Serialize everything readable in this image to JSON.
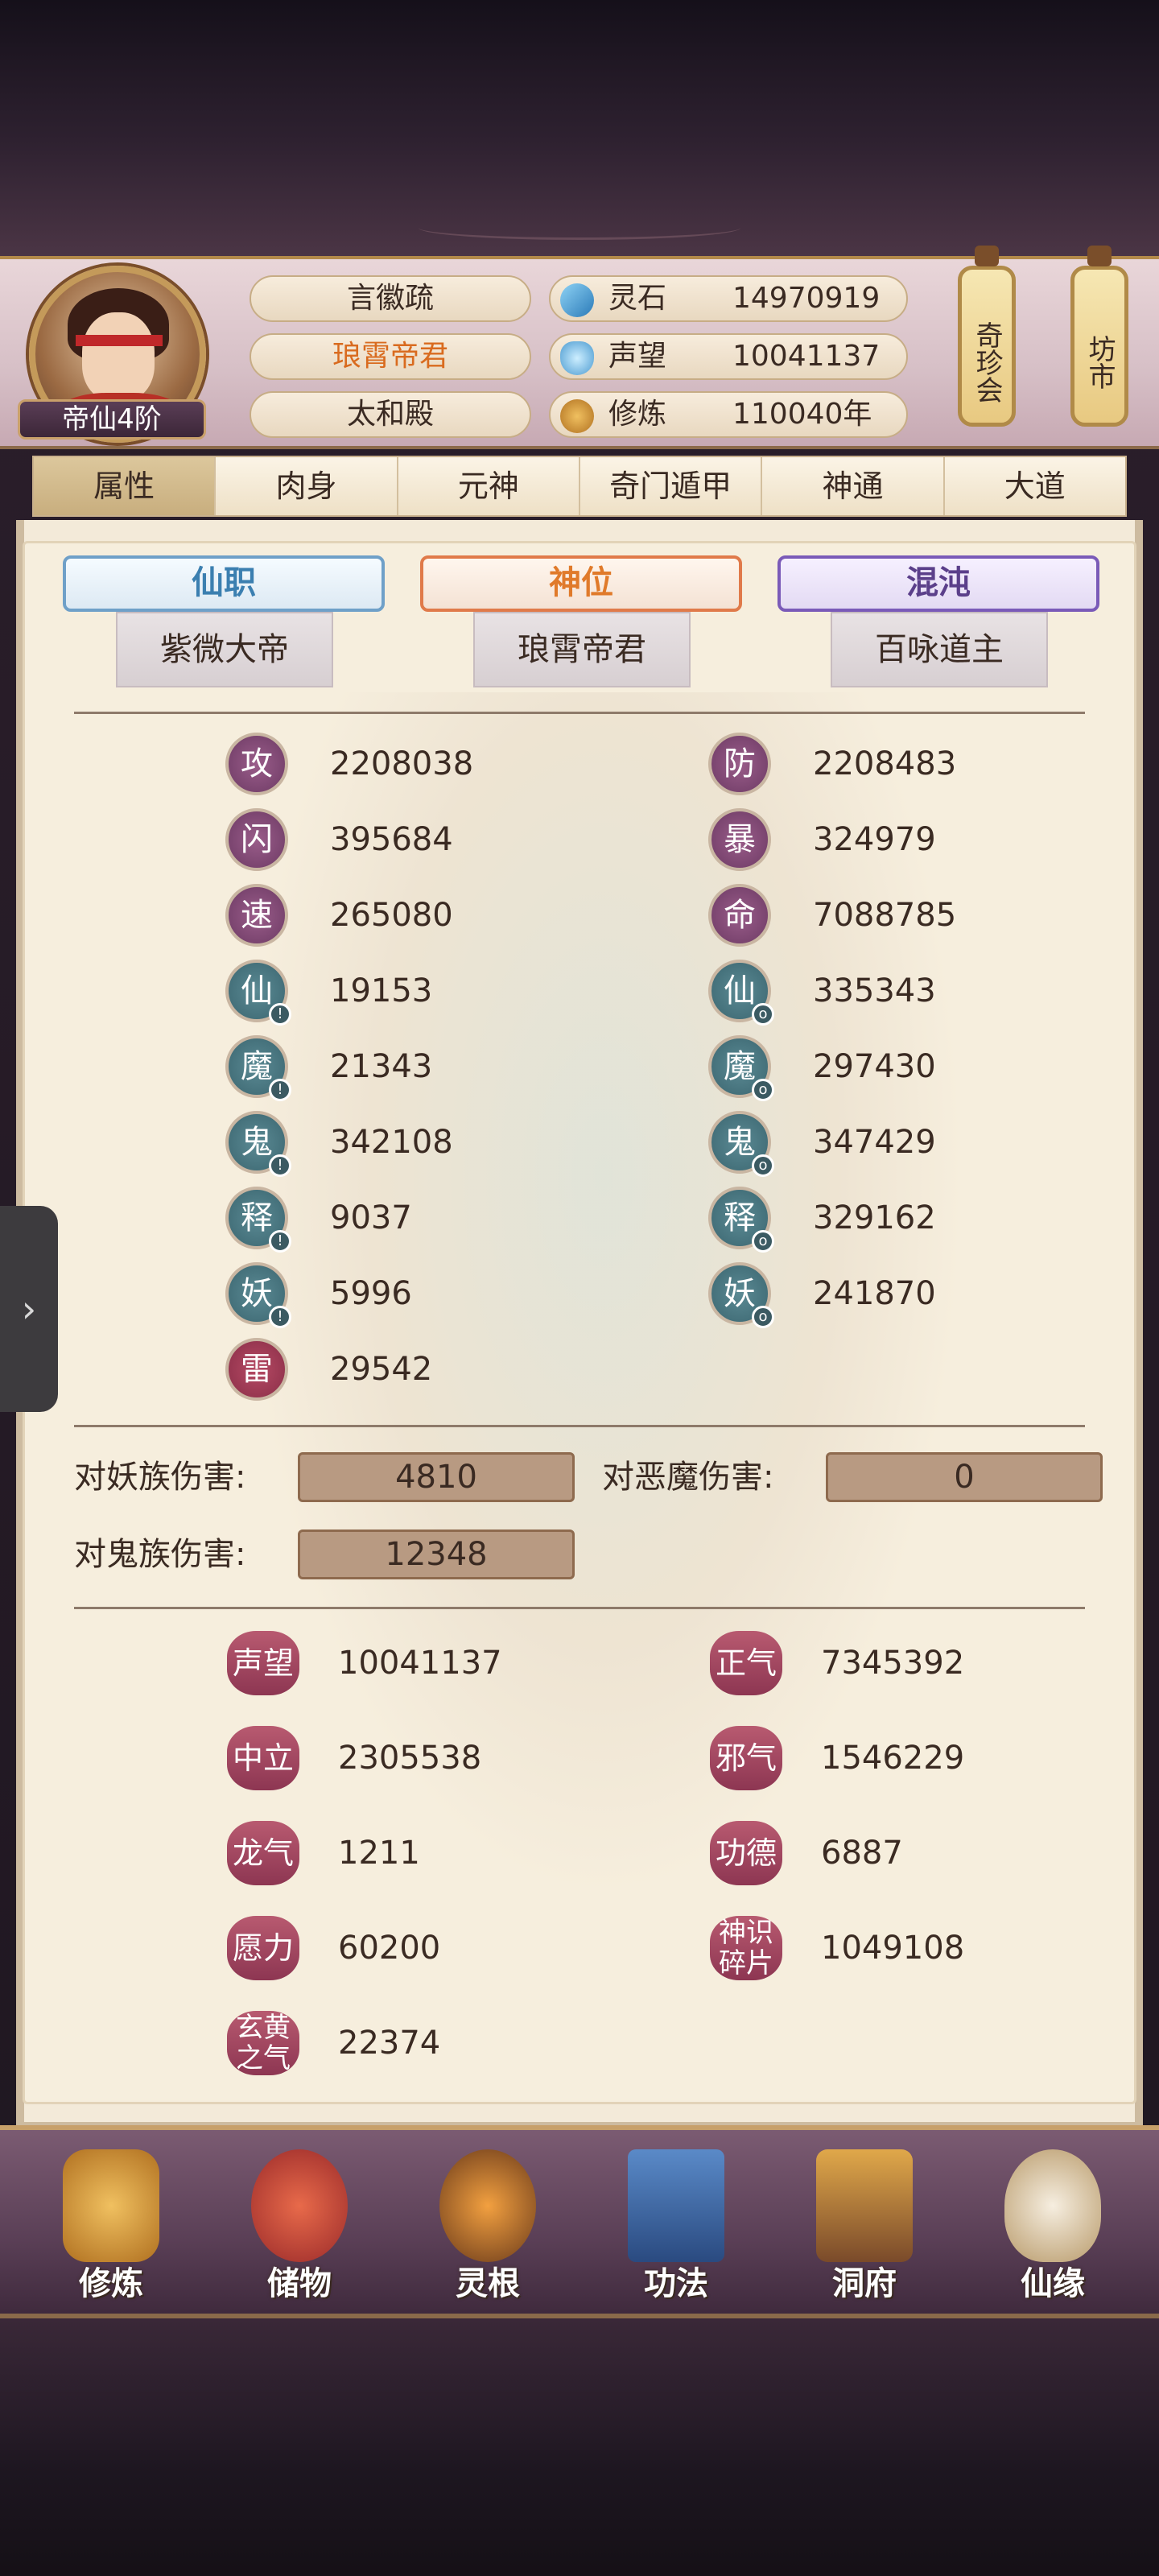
{
  "player": {
    "rank": "帝仙4阶",
    "names": [
      "言徽疏",
      "琅霄帝君",
      "太和殿"
    ]
  },
  "resources": [
    {
      "label": "灵石",
      "value": "14970919",
      "icon": "spirit-stone-icon"
    },
    {
      "label": "声望",
      "value": "10041137",
      "icon": "prestige-crystal-icon"
    },
    {
      "label": "修炼",
      "value": "110040年",
      "icon": "meditation-icon"
    }
  ],
  "lanterns": [
    "奇珍会",
    "坊市"
  ],
  "tabs": [
    "属性",
    "肉身",
    "元神",
    "奇门遁甲",
    "神通",
    "大道"
  ],
  "titles": [
    {
      "heading": "仙职",
      "value": "紫微大帝",
      "color": "#3b7fb0"
    },
    {
      "heading": "神位",
      "value": "琅霄帝君",
      "color": "#e07a2a"
    },
    {
      "heading": "混沌",
      "value": "百咏道主",
      "color": "#5b3f8a"
    }
  ],
  "stats_left": [
    {
      "icon": "攻",
      "value": "2208038",
      "style": "purple",
      "mark": false
    },
    {
      "icon": "闪",
      "value": "395684",
      "style": "purple",
      "mark": false
    },
    {
      "icon": "速",
      "value": "265080",
      "style": "purple",
      "mark": false
    },
    {
      "icon": "仙",
      "value": "19153",
      "style": "teal",
      "mark": true
    },
    {
      "icon": "魔",
      "value": "21343",
      "style": "teal",
      "mark": true
    },
    {
      "icon": "鬼",
      "value": "342108",
      "style": "teal",
      "mark": true
    },
    {
      "icon": "释",
      "value": "9037",
      "style": "teal",
      "mark": true
    },
    {
      "icon": "妖",
      "value": "5996",
      "style": "teal",
      "mark": true
    },
    {
      "icon": "雷",
      "value": "29542",
      "style": "red",
      "mark": false
    }
  ],
  "stats_right": [
    {
      "icon": "防",
      "value": "2208483",
      "style": "purple",
      "mark": false
    },
    {
      "icon": "暴",
      "value": "324979",
      "style": "purple",
      "mark": false
    },
    {
      "icon": "命",
      "value": "7088785",
      "style": "purple",
      "mark": false
    },
    {
      "icon": "仙",
      "value": "335343",
      "style": "teal",
      "mark": true
    },
    {
      "icon": "魔",
      "value": "297430",
      "style": "teal",
      "mark": true
    },
    {
      "icon": "鬼",
      "value": "347429",
      "style": "teal",
      "mark": true
    },
    {
      "icon": "释",
      "value": "329162",
      "style": "teal",
      "mark": true
    },
    {
      "icon": "妖",
      "value": "241870",
      "style": "teal",
      "mark": true
    }
  ],
  "damage": [
    {
      "label": "对妖族伤害:",
      "value": "4810"
    },
    {
      "label": "对恶魔伤害:",
      "value": "0"
    },
    {
      "label": "对鬼族伤害:",
      "value": "12348"
    }
  ],
  "reputation_left": [
    {
      "label": "声望",
      "value": "10041137"
    },
    {
      "label": "中立",
      "value": "2305538"
    },
    {
      "label": "龙气",
      "value": "1211"
    },
    {
      "label": "愿力",
      "value": "60200"
    },
    {
      "label": "玄黄之气",
      "value": "22374"
    }
  ],
  "reputation_right": [
    {
      "label": "正气",
      "value": "7345392"
    },
    {
      "label": "邪气",
      "value": "1546229"
    },
    {
      "label": "功德",
      "value": "6887"
    },
    {
      "label": "神识碎片",
      "value": "1049108"
    }
  ],
  "bottom_nav": [
    {
      "label": "修炼",
      "icon": "cultivation-icon",
      "color": "#d9a24a"
    },
    {
      "label": "储物",
      "icon": "storage-bag-icon",
      "color": "#c84a3a"
    },
    {
      "label": "灵根",
      "icon": "spirit-root-icon",
      "color": "#8a5a2a"
    },
    {
      "label": "功法",
      "icon": "technique-book-icon",
      "color": "#3a6aa0"
    },
    {
      "label": "洞府",
      "icon": "cave-dwelling-icon",
      "color": "#c78a3a"
    },
    {
      "label": "仙缘",
      "icon": "fate-gourd-icon",
      "color": "#d8c8a8"
    }
  ],
  "side_tab": {
    "label": "›"
  }
}
